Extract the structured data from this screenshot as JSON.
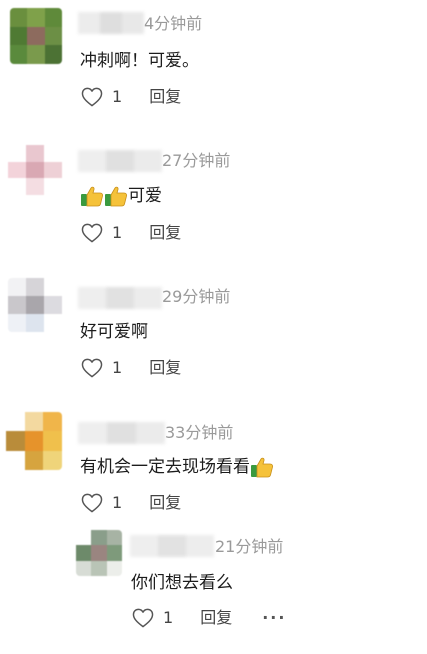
{
  "comments": [
    {
      "time": "4分钟前",
      "text": "冲刺啊！可爱。",
      "likes": "1",
      "reply_label": "回复"
    },
    {
      "time": "27分钟前",
      "text": "可爱",
      "likes": "1",
      "reply_label": "回复"
    },
    {
      "time": "29分钟前",
      "text": "好可爱啊",
      "likes": "1",
      "reply_label": "回复"
    },
    {
      "time": "33分钟前",
      "text": "有机会一定去现场看看",
      "likes": "1",
      "reply_label": "回复"
    }
  ],
  "reply": {
    "time": "21分钟前",
    "text": "你们想去看么",
    "likes": "1",
    "reply_label": "回复",
    "more": "···"
  },
  "icons": {
    "like": "heart-outline-icon",
    "emoji": "thumbs-up-emoji-icon",
    "more": "more-options-icon"
  },
  "colors": {
    "text": "#1c1c1c",
    "meta": "#9a9a9a",
    "action": "#444444",
    "emoji_yellow": "#f5c23a",
    "emoji_green": "#3a9a3f"
  }
}
